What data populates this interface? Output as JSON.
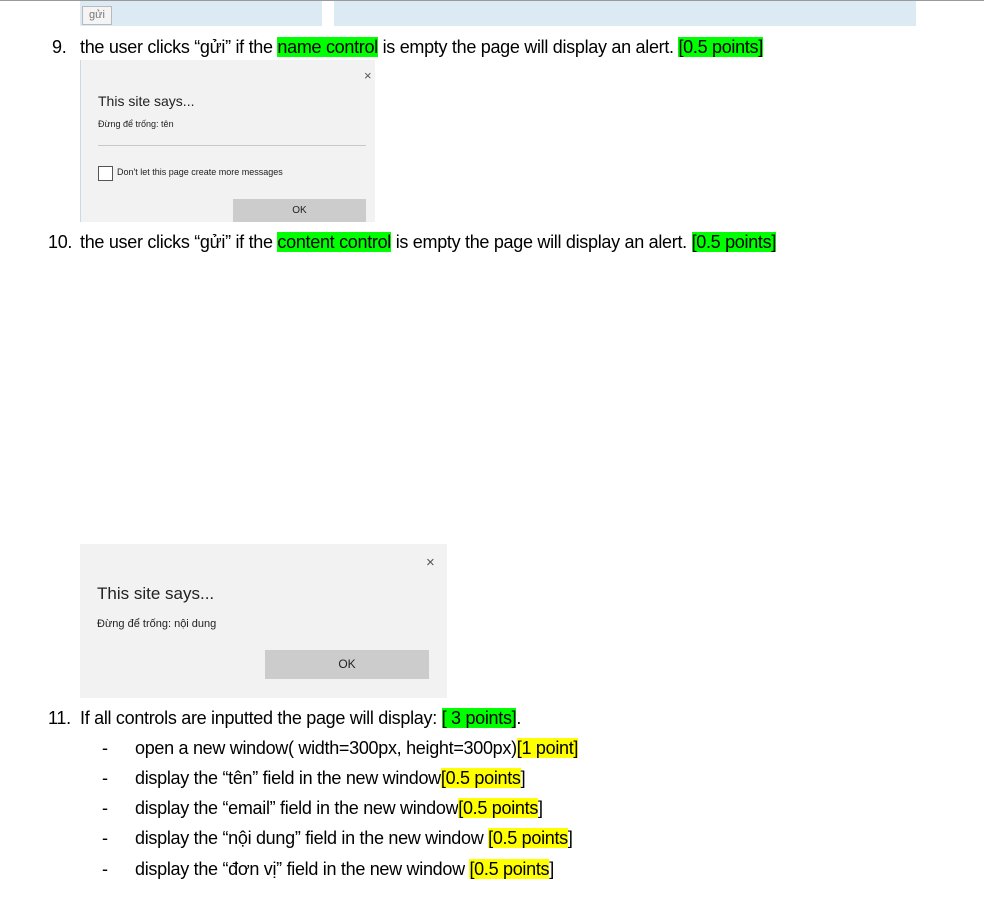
{
  "top": {
    "button_label": "gửi"
  },
  "items": {
    "q9": {
      "number": "9.",
      "text_a": "the user clicks “gửi” if the ",
      "highlight": "name control",
      "text_b": " is empty the page will display an alert. ",
      "points": "[0.5 points]"
    },
    "q10": {
      "number": "10.",
      "text_a": "the user clicks “gửi” if the ",
      "highlight": "content control",
      "text_b": " is empty the page will display an alert. ",
      "points": "[0.5 points]"
    },
    "q11": {
      "number": "11.",
      "text_a": "If all controls are inputted the page will display:  ",
      "points": "[ 3 points]",
      "text_b": "."
    }
  },
  "dialog1": {
    "close": "×",
    "title": "This site says...",
    "message": "Đừng để trống:  tên",
    "checkbox_label": "Don't let this page create more messages",
    "ok_label": "OK"
  },
  "dialog2": {
    "close": "×",
    "title": "This site says...",
    "message": "Đừng để trống:  nội dung",
    "ok_label": "OK"
  },
  "bullets": [
    {
      "dash": "-",
      "text": "open a new window( width=300px, height=300px)",
      "points": "[1 point]",
      "tail": ""
    },
    {
      "dash": "-",
      "text": "display the “tên” field in the new window",
      "points": "[0.5 points",
      "tail": "]"
    },
    {
      "dash": "-",
      "text": "display the “email” field in the new window",
      "points": "[0.5 points",
      "tail": "]"
    },
    {
      "dash": "-",
      "text": "display the “nội dung” field in the new window ",
      "points": "[0.5 points",
      "tail": "]"
    },
    {
      "dash": "-",
      "text": "display the “đơn vị” field in the new window ",
      "points": "[0.5 points",
      "tail": "]"
    }
  ]
}
